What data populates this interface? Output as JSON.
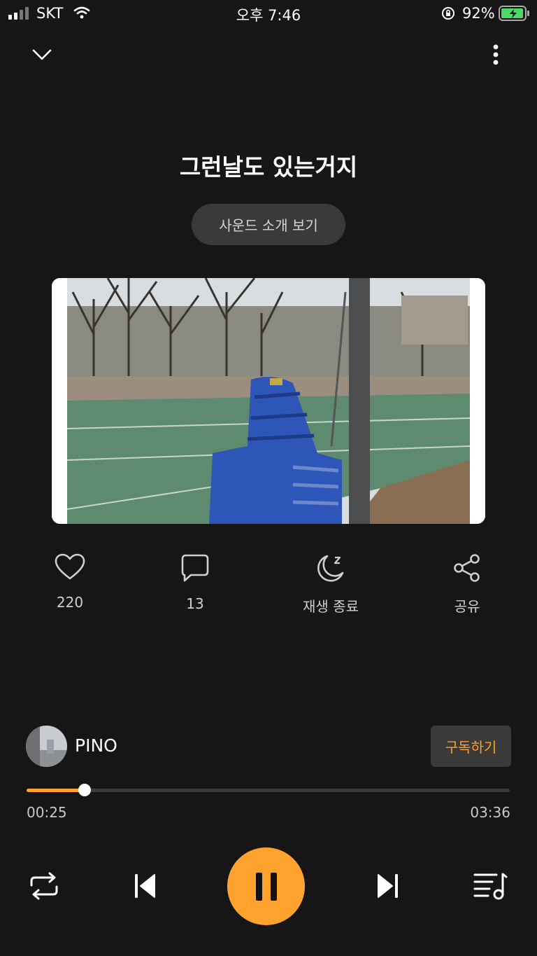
{
  "status_bar": {
    "carrier": "SKT",
    "time": "오후 7:46",
    "battery_pct": "92%"
  },
  "track": {
    "title": "그런날도 있는거지",
    "intro_button": "사운드 소개 보기"
  },
  "actions": {
    "like_count": "220",
    "comment_count": "13",
    "sleep_label": "재생 종료",
    "share_label": "공유"
  },
  "artist": {
    "name": "PINO",
    "subscribe_label": "구독하기"
  },
  "player": {
    "current_time": "00:25",
    "duration": "03:36",
    "progress": 0.12
  },
  "colors": {
    "accent": "#ffa22e",
    "background": "#161616"
  }
}
